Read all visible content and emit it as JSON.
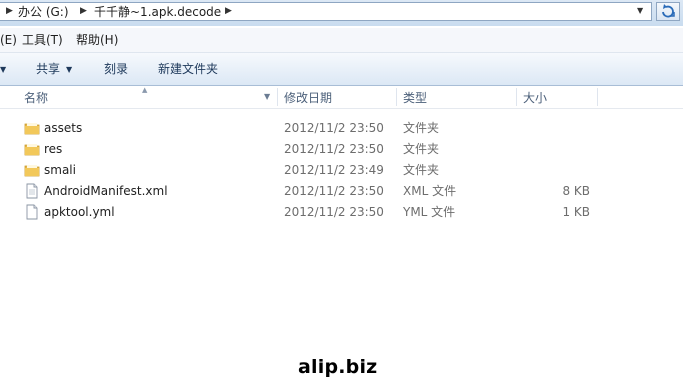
{
  "address": {
    "crumbs": [
      "办公 (G:)",
      "千千静~1.apk.decode"
    ]
  },
  "menubar": {
    "items": [
      "(E)",
      "工具(T)",
      "帮助(H)"
    ]
  },
  "toolbar": {
    "share_label": "共享",
    "burn_label": "刻录",
    "new_folder_label": "新建文件夹"
  },
  "columns": {
    "name": "名称",
    "date": "修改日期",
    "type": "类型",
    "size": "大小"
  },
  "files": [
    {
      "name": "assets",
      "date": "2012/11/2 23:50",
      "type": "文件夹",
      "size": "",
      "icon": "folder-icon"
    },
    {
      "name": "res",
      "date": "2012/11/2 23:50",
      "type": "文件夹",
      "size": "",
      "icon": "folder-icon"
    },
    {
      "name": "smali",
      "date": "2012/11/2 23:49",
      "type": "文件夹",
      "size": "",
      "icon": "folder-icon"
    },
    {
      "name": "AndroidManifest.xml",
      "date": "2012/11/2 23:50",
      "type": "XML 文件",
      "size": "8 KB",
      "icon": "xml-file-icon"
    },
    {
      "name": "apktool.yml",
      "date": "2012/11/2 23:50",
      "type": "YML 文件",
      "size": "1 KB",
      "icon": "yml-file-icon"
    }
  ],
  "watermark": "alip.biz",
  "colors": {
    "folder": "#e8b84a",
    "accent": "#1e395b",
    "chrome": "#dce8f5"
  }
}
